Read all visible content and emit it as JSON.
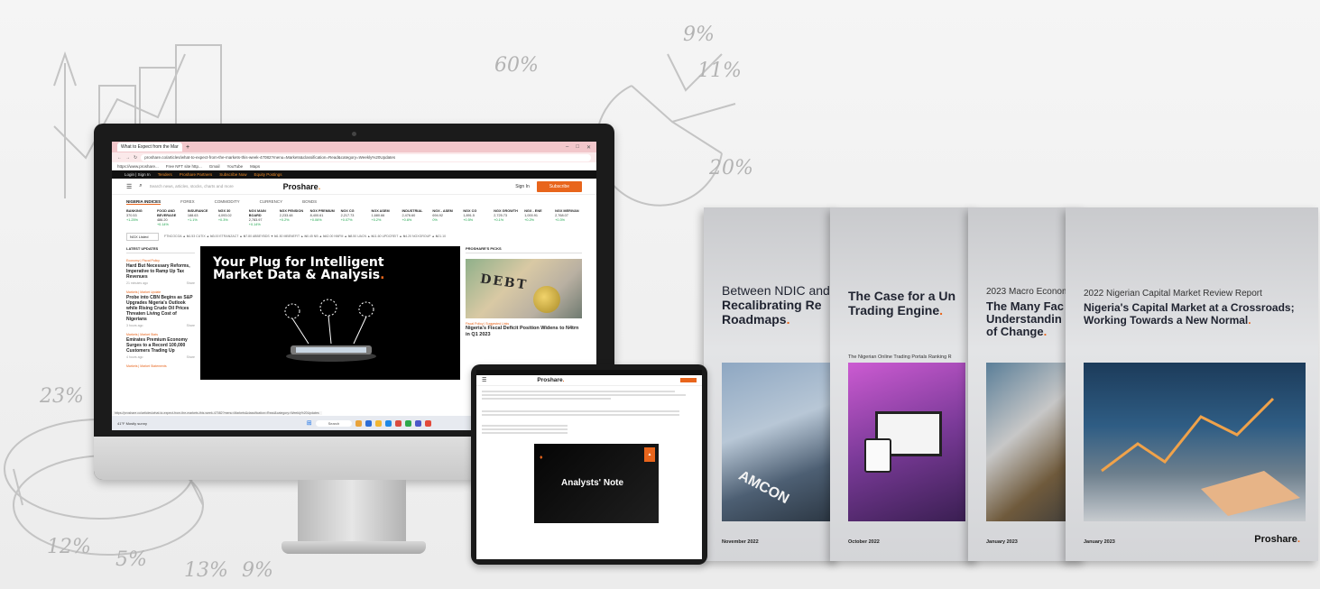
{
  "background": {
    "sketch_labels": [
      "60%",
      "9%",
      "11%",
      "20%",
      "23%",
      "12%",
      "5%",
      "13%",
      "9%"
    ]
  },
  "browser": {
    "tab_title": "What to Expect from the Market thi",
    "url": "proshare.co/articles/what-to-expect-from-the-markets-this-week-47082?menu=Markets&classification=Read&category=Weekly%20Updates",
    "bookmarks": [
      "https://www.proshare...",
      "Free NFT site http...",
      "Gmail",
      "YouTube",
      "Maps"
    ],
    "status_url": "https://proshare.co/articles/what-to-expect-from-the-markets-this-week-47082?menu=Markets&classification=Read&category=Weekly%20Updates"
  },
  "site": {
    "topbar": [
      "Login | Sign In",
      "Tenders",
      "Proshare Partners",
      "Subscribe Now",
      "Equity Postings"
    ],
    "search_placeholder": "Search news, articles, stocks, charts and more",
    "logo": "Proshare",
    "signin_label": "Sign In",
    "subscribe_label": "Subscribe",
    "market_tabs": [
      "NIGERIA INDICES",
      "FOREX",
      "COMMODITY",
      "CURRENCY",
      "BONDS"
    ],
    "indices": [
      {
        "name": "BANKING",
        "value": "370.53",
        "change": "+1.25%"
      },
      {
        "name": "FOOD AND BEVERAGE",
        "value": "486.20",
        "change": "+0.14%"
      },
      {
        "name": "INSURANCE",
        "value": "188.63",
        "change": "+1.1%"
      },
      {
        "name": "NGX 30",
        "value": "4,093.02",
        "change": "+0.3%"
      },
      {
        "name": "NGX MAIN BOARD",
        "value": "2,783.97",
        "change": "+0.14%"
      },
      {
        "name": "NGX PENSION",
        "value": "2,233.48",
        "change": "+0.2%"
      },
      {
        "name": "NGX PREMIUM",
        "value": "8,400.61",
        "change": "+0.06%"
      },
      {
        "name": "NGX CG",
        "value": "2,217.73",
        "change": "+0.07%"
      },
      {
        "name": "NGX ASEM",
        "value": "1,680.66",
        "change": "+0.2%"
      },
      {
        "name": "INDUSTRIAL",
        "value": "2,476.60",
        "change": "+0.6%"
      },
      {
        "name": "NGX - ASEM",
        "value": "694.92",
        "change": "0%"
      },
      {
        "name": "NGX CG",
        "value": "1,891.5",
        "change": "+0.5%"
      },
      {
        "name": "NGX GROWTH",
        "value": "2,725.73",
        "change": "+0.1%"
      },
      {
        "name": "NGX - ENE",
        "value": "1,000.91",
        "change": "+0.2%"
      },
      {
        "name": "NGX MERIVAN",
        "value": "2,768.07",
        "change": "+0.3%"
      }
    ],
    "ticker_select": "NGX Listed",
    "ticker_text": "FTNCOCOA ▲ ₦1.53  CUTIX ▲ ₦3.00  ETRANZACT ▲ ₦7.80  ABBEYBDS ▼ ₦1.50  MBENEFIT ▲ ₦0.45  NB ▲ ₦42.00  NNFM ▲ ₦8.50  UACN ▲ ₦11.60  UPDCREIT ▲ ₦4.20  NGXGROUP ▲ ₦21.10",
    "latest_heading": "LATEST UPDATES",
    "latest": [
      {
        "tag": "Economy | Fiscal Policy",
        "title": "Hard But Necessary Reforms, Imperative to Ramp Up Tax Revenues",
        "time": "21 minutes ago",
        "more": "Share"
      },
      {
        "tag": "Markets | Market Update",
        "title": "Probe into CBN Begins as S&P Upgrades Nigeria's Outlook while Rising Crude Oil Prices Threaten Living Cost of Nigerians",
        "time": "3 hours ago",
        "more": "Share"
      },
      {
        "tag": "Markets | Market Stats",
        "title": "Emirates Premium Economy Surges to a Record 100,000 Customers Trading Up",
        "time": "4 hours ago",
        "more": "Share"
      },
      {
        "tag": "Markets | Market Statements",
        "title": "",
        "time": "",
        "more": ""
      }
    ],
    "hero_title_l1": "Your Plug for Intelligent",
    "hero_title_l2": "Market Data & Analysis",
    "picks_heading": "PROSHARE'S PICKS",
    "pick_image_text": "DEBT",
    "pick_tag": "Fiscal Policy | Suggested Links",
    "pick_title": "Nigeria's Fiscal Deficit Position Widens to N4trn in Q1 2023"
  },
  "taskbar": {
    "weather": "41°F Mostly sunny",
    "search": "Search"
  },
  "tablet": {
    "logo": "Proshare",
    "hero_title": "Analysts' Note"
  },
  "reports": [
    {
      "pre": "",
      "title_l1": "Between NDIC and",
      "title_l2": "Recalibrating Re",
      "title_l3": "Roadmaps",
      "image_text": "AMCON",
      "date": "November 2022"
    },
    {
      "pre": "",
      "title_l1": "The Case for a Un",
      "title_l2": "Trading Engine",
      "subtitle": "The Nigerian Online Trading Portals Ranking R",
      "date": "October 2022"
    },
    {
      "pre": "2023 Macro Econom",
      "title_l1": "The Many Fac",
      "title_l2": "Understandin",
      "title_l3": "of Change",
      "date": "January 2023"
    },
    {
      "pre": "2022 Nigerian Capital Market Review Report",
      "title_l1": "Nigeria's Capital Market at a Crossroads;",
      "title_l2": "Working Towards a New Normal",
      "date": "January 2023",
      "brand": "Proshare"
    }
  ],
  "colors": {
    "brand_orange": "#e8651c",
    "monitor_bezel": "#1b1b1b",
    "report_cover": "#d4d5d8"
  }
}
